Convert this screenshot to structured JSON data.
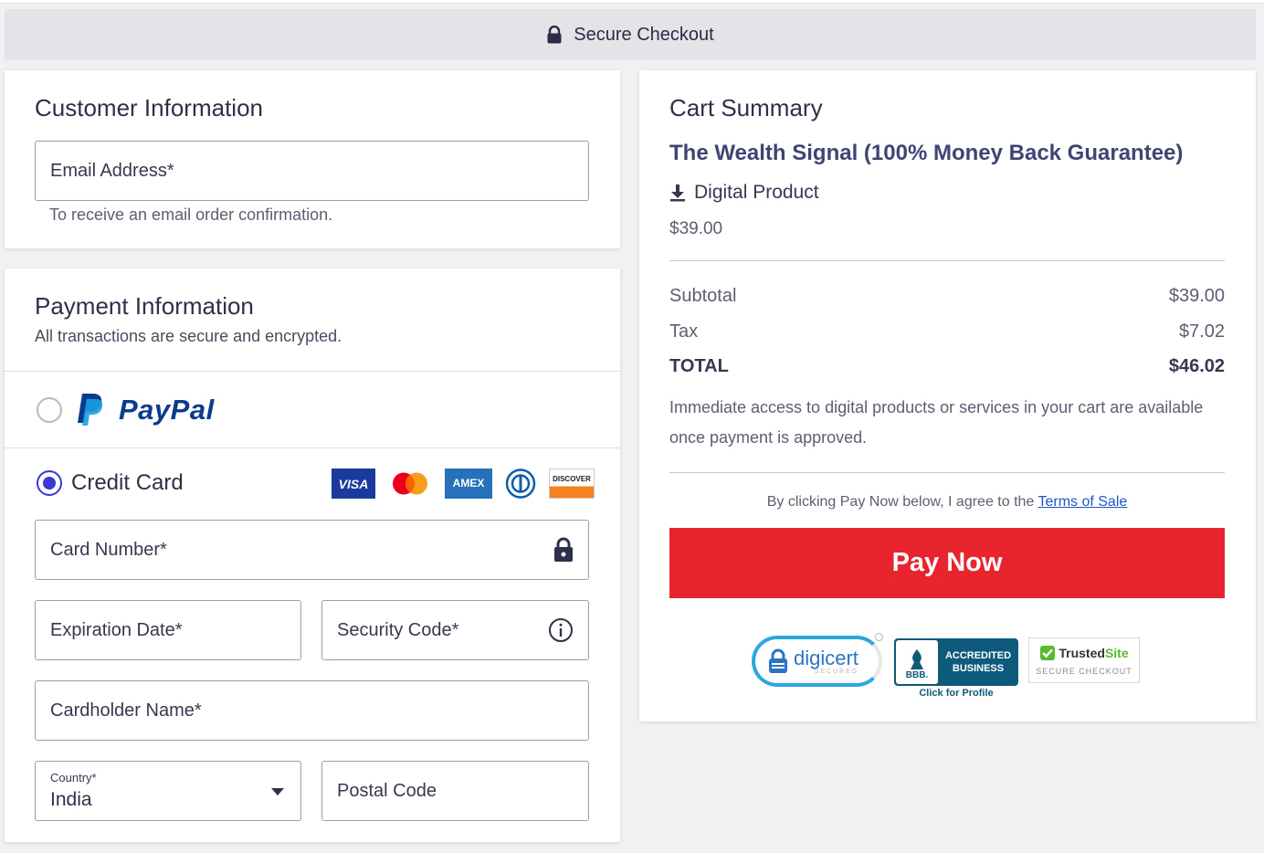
{
  "banner": {
    "title": "Secure Checkout",
    "icon": "lock-icon"
  },
  "customer": {
    "heading": "Customer Information",
    "email_label": "Email Address*",
    "email_help": "To receive an email order confirmation."
  },
  "payment": {
    "heading": "Payment Information",
    "subtitle": "All transactions are secure and encrypted.",
    "paypal_label": "PayPal",
    "credit_label": "Credit Card",
    "card_brands": [
      "VISA",
      "Mastercard",
      "AMEX",
      "Diners",
      "DISCOVER"
    ],
    "card_number_label": "Card Number*",
    "expiration_label": "Expiration Date*",
    "security_label": "Security Code*",
    "cardholder_label": "Cardholder Name*",
    "country_label": "Country*",
    "country_value": "India",
    "postal_label": "Postal Code"
  },
  "cart": {
    "heading": "Cart Summary",
    "product_name": "The Wealth Signal (100% Money Back Guarantee)",
    "product_type": "Digital Product",
    "product_price": "$39.00",
    "subtotal_label": "Subtotal",
    "subtotal_value": "$39.00",
    "tax_label": "Tax",
    "tax_value": "$7.02",
    "total_label": "TOTAL",
    "total_value": "$46.02",
    "access_note": "Immediate access to digital products or services in your cart are available once payment is approved.",
    "agree_prefix": "By clicking Pay Now below, I agree to the",
    "terms_link": "Terms of Sale",
    "pay_button": "Pay Now",
    "digicert_text": "digicert",
    "digicert_sub": "SECURED",
    "bbb_line1": "ACCREDITED",
    "bbb_line2": "BUSINESS",
    "bbb_mark": "BBB.",
    "bbb_link": "Click for Profile",
    "trusted_a": "Trusted",
    "trusted_b": "Site",
    "trusted_sub": "SECURE CHECKOUT"
  },
  "colors": {
    "accent": "#3d35e0",
    "pay_button": "#e8252f",
    "product_title": "#3f4473",
    "bbb_blue": "#0e5a7a"
  }
}
